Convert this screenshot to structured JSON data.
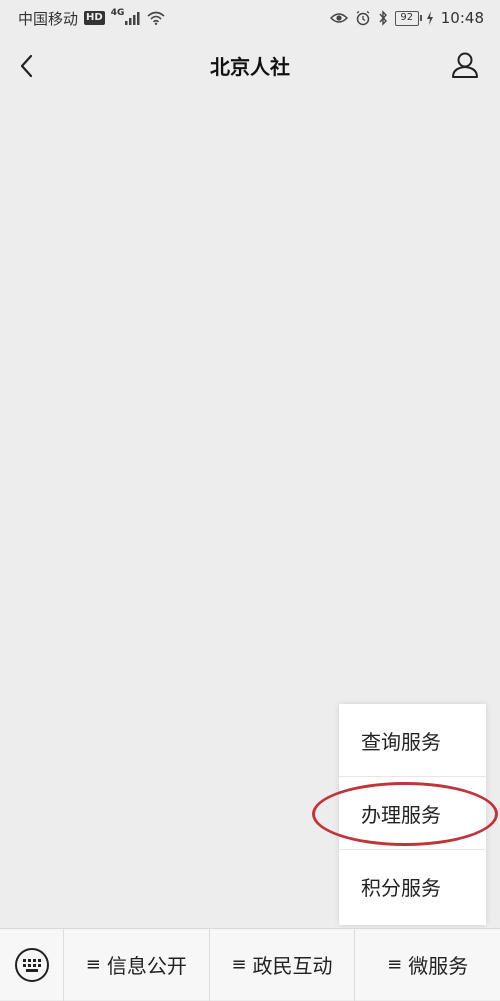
{
  "status_bar": {
    "carrier": "中国移动",
    "hd_badge": "HD",
    "network": "4G",
    "battery": "92",
    "time": "10:48"
  },
  "nav": {
    "title": "北京人社",
    "back_icon": "chevron-left-icon",
    "profile_icon": "user-icon"
  },
  "popup_menu": {
    "items": [
      {
        "label": "查询服务"
      },
      {
        "label": "办理服务"
      },
      {
        "label": "积分服务"
      }
    ],
    "highlighted_index": 1,
    "highlight_color": "#c0343b"
  },
  "bottom_menu": {
    "keyboard_icon": "keyboard-icon",
    "menu_glyph": "≡",
    "tabs": [
      {
        "label": "信息公开"
      },
      {
        "label": "政民互动"
      },
      {
        "label": "微服务"
      }
    ]
  },
  "colors": {
    "background": "#ededed",
    "bottom_bar": "#f7f7f7"
  }
}
